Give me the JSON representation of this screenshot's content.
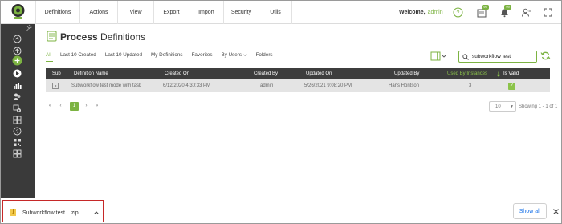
{
  "nav": {
    "items": [
      {
        "label": "Definitions"
      },
      {
        "label": "Actions"
      },
      {
        "label": "View"
      },
      {
        "label": "Export"
      },
      {
        "label": "Import"
      },
      {
        "label": "Security"
      },
      {
        "label": "Utils"
      }
    ],
    "welcome_label": "Welcome,",
    "username": "admin",
    "notifications": {
      "news_count": "99",
      "alerts_count": "99"
    },
    "icons": [
      "help-icon",
      "news-icon",
      "bell-icon",
      "user-settings-icon",
      "expand-icon"
    ]
  },
  "sidebar": {
    "icons": [
      "pin-icon",
      "dashboard-icon",
      "upload-icon",
      "add-icon",
      "process-icon",
      "analytics-icon",
      "users-icon",
      "settings-icon",
      "grid-icon",
      "help-icon",
      "qr-icon",
      "apps-icon"
    ]
  },
  "page": {
    "title_bold": "Process",
    "title_rest": " Definitions"
  },
  "tabs": [
    {
      "label": "All",
      "active": true
    },
    {
      "label": "Last 10 Created"
    },
    {
      "label": "Last 10 Updated"
    },
    {
      "label": "My Definitions"
    },
    {
      "label": "Favorites"
    },
    {
      "label": "By Users ⌵"
    },
    {
      "label": "Folders"
    }
  ],
  "search": {
    "value": "subworkflow test"
  },
  "table": {
    "headers": {
      "sub": "Sub",
      "name": "Definition Name",
      "created_on": "Created On",
      "created_by": "Created By",
      "updated_on": "Updated On",
      "updated_by": "Updated By",
      "used_by": "Used By Instances",
      "is_valid": "Is Valid"
    },
    "rows": [
      {
        "name": "Subworkflow test mode with task",
        "created_on": "6/12/2020 4:30:33 PM",
        "created_by": "admin",
        "updated_on": "5/26/2021 9:08:20 PM",
        "updated_by": "Hans Hontson",
        "used_by": "3",
        "is_valid": "✓"
      }
    ]
  },
  "pagination": {
    "first": "«",
    "prev": "‹",
    "current": "1",
    "next": "›",
    "last": "»",
    "page_size": "10",
    "showing": "Showing 1 - 1 of 1"
  },
  "download": {
    "file_name": "Subworkflow test....zip",
    "show_all": "Show all"
  },
  "colors": {
    "accent": "#7cb342",
    "sidebar_bg": "#3a3a3a",
    "header_bg": "#3d3d3d",
    "highlight": "#c62828"
  }
}
